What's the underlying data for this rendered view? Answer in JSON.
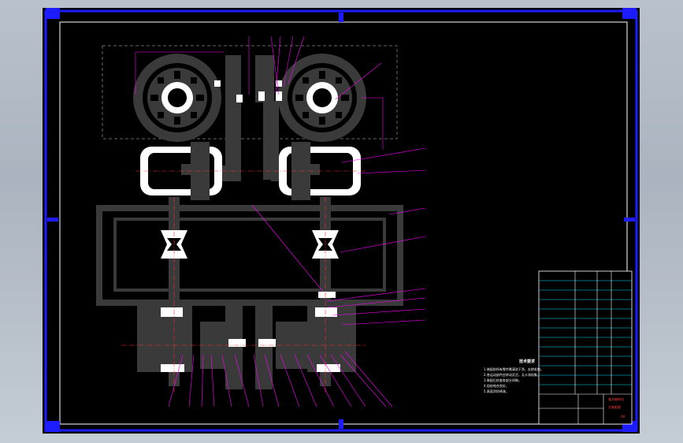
{
  "window": {
    "background": "#b4bec9"
  },
  "drawing": {
    "frame_color": "#1c1cff",
    "line_colors": {
      "part": "#3a3a3a",
      "white": "#ffffff",
      "leader": "#ff00ff",
      "center": "#ff3030",
      "title_text": "#ff3030",
      "table_text": "#00e0ff"
    }
  },
  "technical_requirements": {
    "title": "技术要求",
    "lines": [
      "1.装配前所有零件需清洗干净，去除毛刺。",
      "2.各运动部件应转动灵活，无卡滞现象。",
      "3.装配后检查各部分间隙。",
      "4.齿轮啮合良好。",
      "5.表面涂防锈漆。"
    ]
  },
  "title_block": {
    "name_line1": "辊式破碎机",
    "name_line2": "总装配图",
    "sheet_code": "A0"
  },
  "icons": [
    "frame-corner-marker-icon",
    "centering-mark-icon"
  ]
}
